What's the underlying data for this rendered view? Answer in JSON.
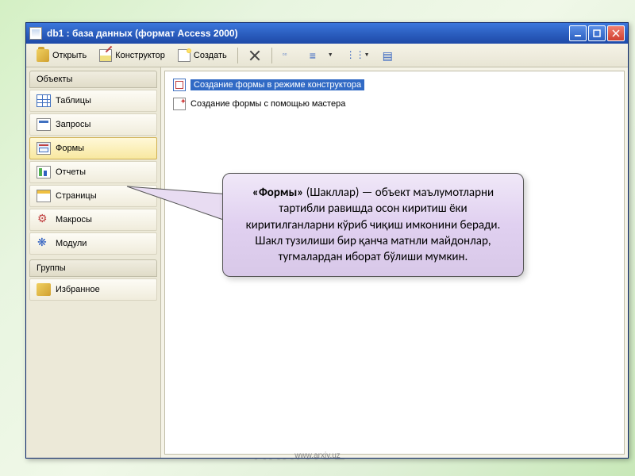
{
  "watermark": "ARXIV.UZ",
  "window": {
    "title": "db1 : база данных (формат Access 2000)"
  },
  "toolbar": {
    "open_label": "Открыть",
    "design_label": "Конструктор",
    "new_label": "Создать"
  },
  "sidebar": {
    "objects_header": "Объекты",
    "groups_header": "Группы",
    "items": [
      {
        "label": "Таблицы"
      },
      {
        "label": "Запросы"
      },
      {
        "label": "Формы"
      },
      {
        "label": "Отчеты"
      },
      {
        "label": "Страницы"
      },
      {
        "label": "Макросы"
      },
      {
        "label": "Модули"
      }
    ],
    "groups": [
      {
        "label": "Избранное"
      }
    ]
  },
  "main": {
    "items": [
      {
        "label": "Создание формы в режиме конструктора"
      },
      {
        "label": "Создание формы с помощью мастера"
      }
    ]
  },
  "callout": {
    "bold": "«Формы»",
    "rest": " (Шакллар) — объект маълумотларни тартибли равишда осон киритиш ёки киритилганларни кўриб чиқиш имконини беради. Шакл тузилиши бир қанча матнли майдонлар, тугмалардан иборат бўлиши мумкин."
  },
  "footer": "www.arxiv.uz"
}
